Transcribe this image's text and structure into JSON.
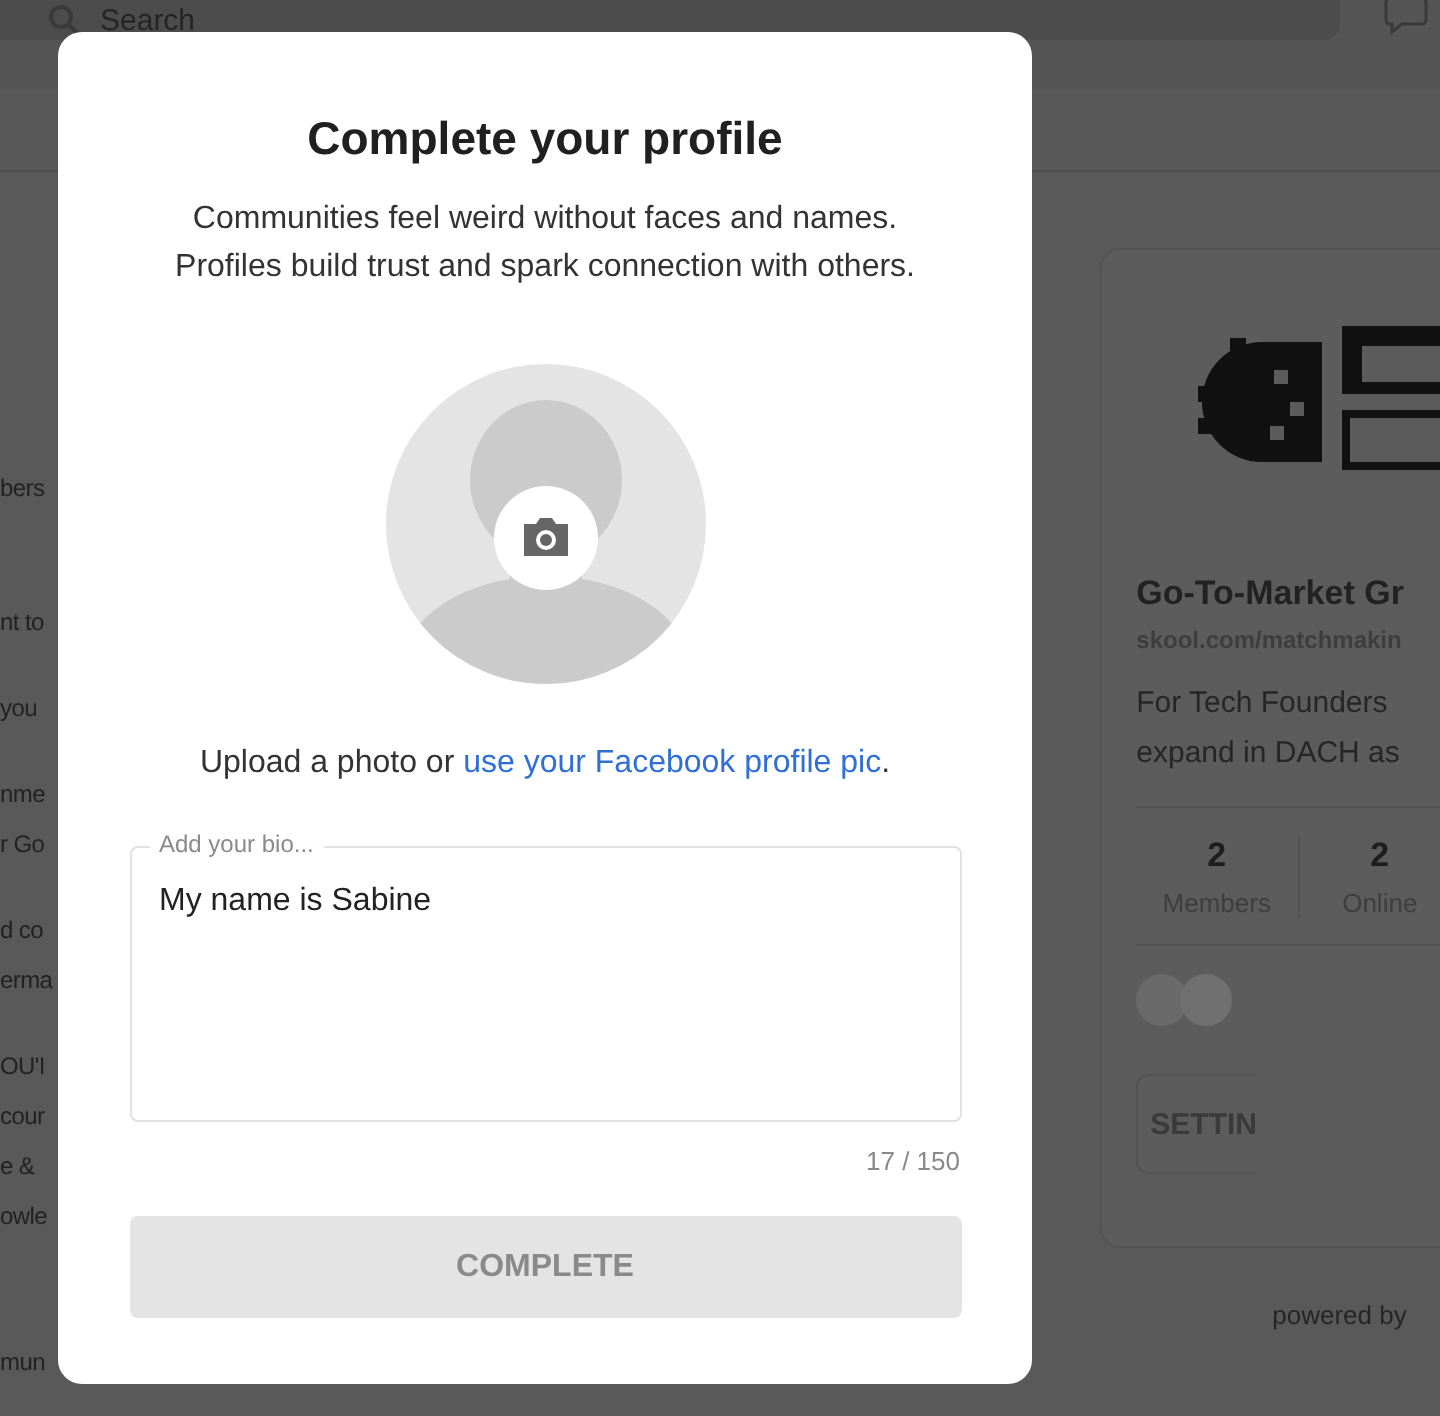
{
  "header": {
    "search": {
      "placeholder": "Search"
    }
  },
  "background_feed": {
    "posts": [
      [
        "bers"
      ],
      [
        "nt to"
      ],
      [
        "you"
      ],
      [
        "nme",
        "r Go"
      ],
      [
        "d co",
        "erma"
      ],
      [
        "OU'I",
        "cour",
        "e &",
        "owle"
      ],
      [
        "mun"
      ]
    ]
  },
  "group_card": {
    "name": "Go-To-Market Gr",
    "url": "skool.com/matchmakin",
    "description": [
      "For Tech Founders",
      "expand in DACH as"
    ],
    "stats": [
      {
        "value": "2",
        "label": "Members"
      },
      {
        "value": "2",
        "label": "Online"
      }
    ],
    "button": "SETTIN",
    "footer": "powered by"
  },
  "dialog": {
    "title": "Complete your profile",
    "subtitle": [
      "Communities feel weird without faces and names.",
      "Profiles build trust and spark connection with others."
    ],
    "upload_prompt": {
      "text": "Upload a photo or ",
      "link": "use your Facebook profile pic",
      "end": "."
    },
    "bio": {
      "placeholder": "Add your bio...",
      "value": "My name is Sabine",
      "counter": "17 / 150"
    },
    "button": {
      "label": "COMPLETE",
      "disabled": true
    }
  }
}
